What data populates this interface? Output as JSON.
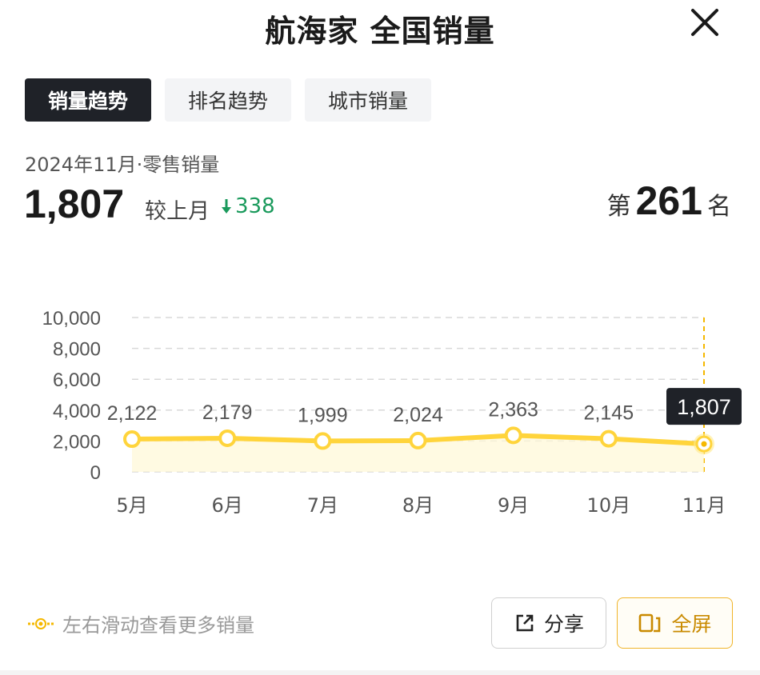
{
  "header": {
    "title": "航海家 全国销量"
  },
  "tabs": [
    {
      "label": "销量趋势",
      "active": true
    },
    {
      "label": "排名趋势",
      "active": false
    },
    {
      "label": "城市销量",
      "active": false
    }
  ],
  "summary": {
    "subtitle": "2024年11月·零售销量",
    "value": "1,807",
    "compare_label": "较上月",
    "delta": "338",
    "delta_direction": "down",
    "rank_prefix": "第",
    "rank": "261",
    "rank_suffix": "名"
  },
  "chart_data": {
    "type": "line",
    "categories": [
      "5月",
      "6月",
      "7月",
      "8月",
      "9月",
      "10月",
      "11月"
    ],
    "values": [
      2122,
      2179,
      1999,
      2024,
      2363,
      2145,
      1807
    ],
    "value_labels": [
      "2,122",
      "2,179",
      "1,999",
      "2,024",
      "2,363",
      "2,145",
      "1,807"
    ],
    "yticks": [
      "0",
      "2,000",
      "4,000",
      "6,000",
      "8,000",
      "10,000"
    ],
    "ylim": [
      0,
      10000
    ],
    "highlight_index": 6,
    "grid": true,
    "colors": {
      "line": "#ffd43b",
      "highlight_bg": "#1f2228",
      "grid": "#d9d9d9"
    }
  },
  "footer": {
    "hint": "左右滑动查看更多销量",
    "share_label": "分享",
    "fullscreen_label": "全屏"
  },
  "colors": {
    "accent": "#ffd43b",
    "down": "#1a9a5c",
    "dark": "#1f2228"
  }
}
